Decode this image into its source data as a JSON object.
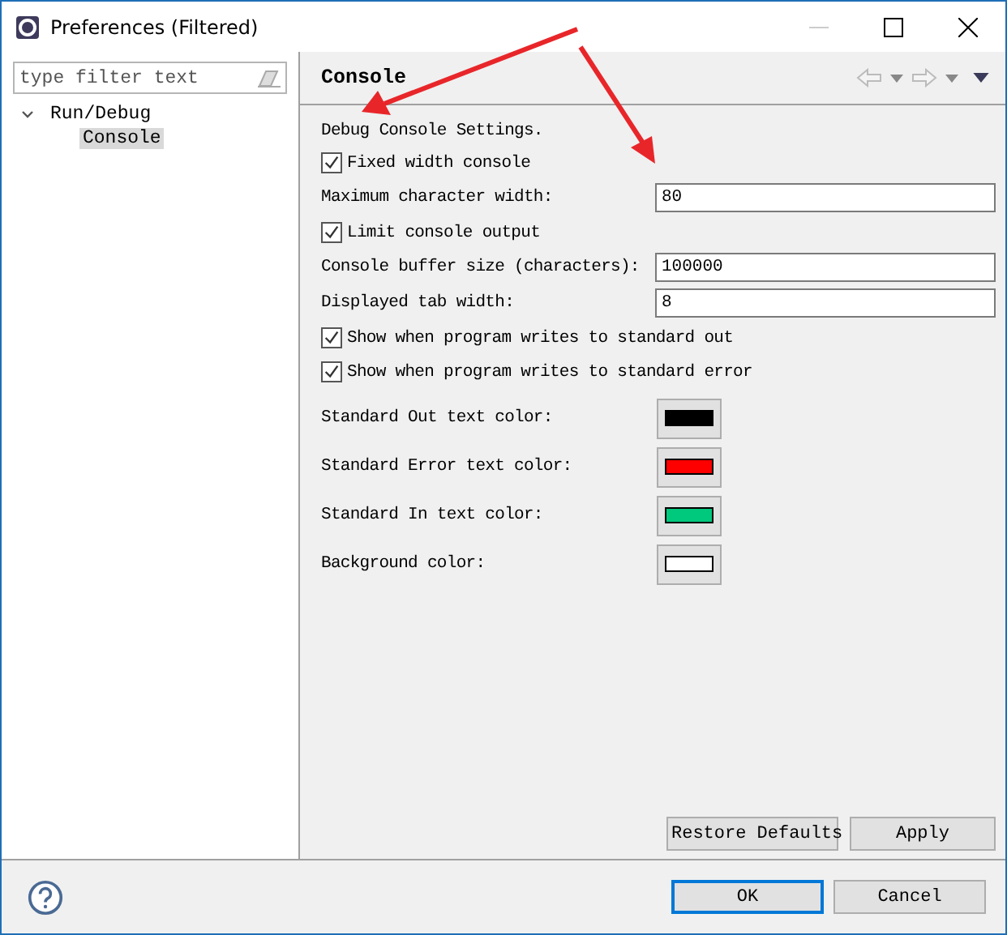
{
  "window": {
    "title": "Preferences (Filtered)"
  },
  "filter": {
    "placeholder": "type filter text"
  },
  "tree": [
    {
      "label": "Run/Debug",
      "expanded": true,
      "selected": false,
      "children": [
        {
          "label": "Console",
          "selected": true
        }
      ]
    }
  ],
  "page": {
    "title": "Console"
  },
  "settings": [
    {
      "kind": "text",
      "label": "Debug Console Settings."
    },
    {
      "kind": "checkbox",
      "label": "Fixed width console",
      "checked": true
    },
    {
      "kind": "field",
      "label": "Maximum character width:",
      "value": "80"
    },
    {
      "kind": "checkbox",
      "label": "Limit console output",
      "checked": true
    },
    {
      "kind": "field",
      "label": "Console buffer size (characters):",
      "value": "100000"
    },
    {
      "kind": "field",
      "label": "Displayed tab width:",
      "value": "8"
    },
    {
      "kind": "checkbox",
      "label": "Show when program writes to standard out",
      "checked": true
    },
    {
      "kind": "checkbox",
      "label": "Show when program writes to standard error",
      "checked": true
    },
    {
      "kind": "color",
      "label": "Standard Out text color:",
      "color": "#000000"
    },
    {
      "kind": "color",
      "label": "Standard Error text color:",
      "color": "#ff0000"
    },
    {
      "kind": "color",
      "label": "Standard In text color:",
      "color": "#00c87d"
    },
    {
      "kind": "color",
      "label": "Background color:",
      "color": "#ffffff"
    }
  ],
  "page_buttons": [
    "Restore Defaults",
    "Apply"
  ],
  "dialog_buttons": [
    {
      "label": "OK",
      "default": true
    },
    {
      "label": "Cancel",
      "default": false
    }
  ]
}
